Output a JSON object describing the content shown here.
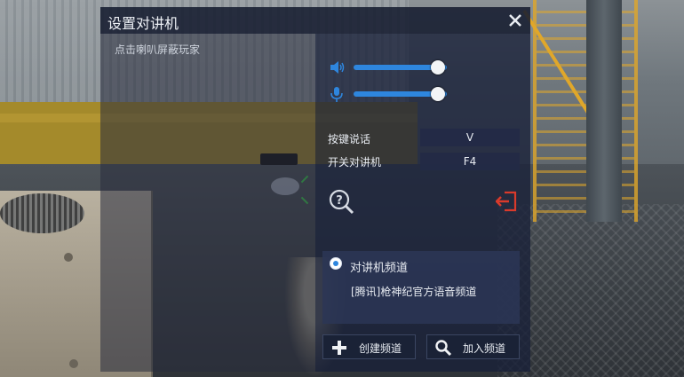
{
  "dialog": {
    "title": "设置对讲机",
    "hint": "点击喇叭屏蔽玩家"
  },
  "sliders": {
    "speaker": {
      "icon": "speaker-icon",
      "level": 0.9
    },
    "microphone": {
      "icon": "microphone-icon",
      "level": 0.9
    }
  },
  "keys": {
    "push_to_talk_label": "按键说话",
    "push_to_talk_value": "V",
    "toggle_label": "开关对讲机",
    "toggle_value": "F4"
  },
  "channel": {
    "heading": "对讲机频道",
    "items": [
      "[腾讯]枪神纪官方语音频道"
    ]
  },
  "buttons": {
    "create": "创建频道",
    "join": "加入频道"
  },
  "colors": {
    "accent": "#2e86de",
    "exit_icon": "#d93a2b"
  }
}
